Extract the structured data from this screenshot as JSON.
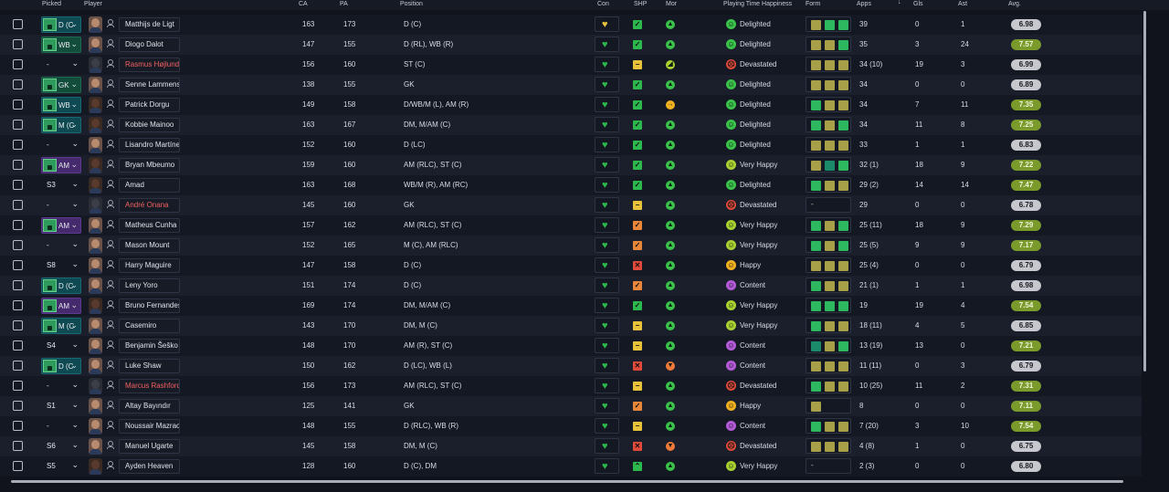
{
  "columns": {
    "picked": "Picked",
    "player": "Player",
    "ca": "CA",
    "pa": "PA",
    "position": "Position",
    "con": "Con",
    "shp": "SHP",
    "mor": "Mor",
    "happiness": "Playing Time Happiness",
    "form": "Form",
    "apps": "Apps",
    "sort_indicator": "↓",
    "gls": "Gls",
    "ast": "Ast",
    "avg": "Avg."
  },
  "colors": {
    "shp_good": "#2db84d",
    "shp_warn_yellow": "#e8c23a",
    "shp_warn_orange": "#e8873a",
    "shp_bad": "#e04a3a",
    "mor_good": "#3ac24a",
    "mor_ok": "#a8d030",
    "mor_warn": "#f0b020",
    "mor_bad": "#f07a3a",
    "hap_delighted": "#3ac24a",
    "hap_very_happy": "#a8d030",
    "hap_happy": "#f0b020",
    "hap_content": "#b45ad8",
    "hap_devastated": "#e04a3a",
    "form_green": "#2db860",
    "form_olive": "#a8a048",
    "form_teal": "#1a8a6a"
  },
  "players": [
    {
      "picked": "D (C",
      "picked_style": "teal",
      "pick_icon": true,
      "name": "Matthijs de Ligt",
      "name_red": false,
      "face": "light",
      "ca": "163",
      "pa": "173",
      "position": "D (C)",
      "con_icon": "heart-yellow",
      "shp": "good",
      "shp_glyph": "✓",
      "mor": "good",
      "mor_glyph": "▲",
      "hap": "delighted",
      "hap_glyph": "☺",
      "happiness": "Delighted",
      "form": [
        "olive",
        "green",
        "green"
      ],
      "form_empty": false,
      "apps": "39",
      "gls": "0",
      "ast": "1",
      "avg": "6.98",
      "avg_hi": false
    },
    {
      "picked": "WB",
      "picked_style": "green",
      "pick_icon": true,
      "name": "Diogo Dalot",
      "name_red": false,
      "face": "light",
      "ca": "147",
      "pa": "155",
      "position": "D (RL), WB (R)",
      "con_icon": "heart",
      "shp": "good",
      "shp_glyph": "✓",
      "mor": "good",
      "mor_glyph": "▲",
      "hap": "delighted",
      "hap_glyph": "☺",
      "happiness": "Delighted",
      "form": [
        "olive",
        "olive",
        "green"
      ],
      "form_empty": false,
      "apps": "35",
      "gls": "3",
      "ast": "24",
      "avg": "7.57",
      "avg_hi": true
    },
    {
      "picked": "-",
      "picked_style": "plain",
      "pick_icon": false,
      "name": "Rasmus Højlund",
      "name_red": true,
      "face": "blank",
      "ca": "156",
      "pa": "160",
      "position": "ST (C)",
      "con_icon": "heart",
      "shp": "warn_yellow",
      "shp_glyph": "−",
      "mor": "ok",
      "mor_glyph": "◢",
      "hap": "devastated",
      "hap_glyph": "☹",
      "happiness": "Devastated",
      "form": [
        "olive",
        "olive",
        "olive"
      ],
      "form_empty": false,
      "apps": "34 (10)",
      "gls": "19",
      "ast": "3",
      "avg": "6.99",
      "avg_hi": false
    },
    {
      "picked": "GK",
      "picked_style": "green",
      "pick_icon": true,
      "name": "Senne Lammens",
      "name_red": false,
      "face": "light",
      "ca": "138",
      "pa": "155",
      "position": "GK",
      "con_icon": "heart",
      "shp": "good",
      "shp_glyph": "✓",
      "mor": "good",
      "mor_glyph": "▲",
      "hap": "delighted",
      "hap_glyph": "☺",
      "happiness": "Delighted",
      "form": [
        "olive",
        "olive",
        "olive"
      ],
      "form_empty": false,
      "apps": "34",
      "gls": "0",
      "ast": "0",
      "avg": "6.89",
      "avg_hi": false
    },
    {
      "picked": "WB",
      "picked_style": "teal",
      "pick_icon": true,
      "name": "Patrick Dorgu",
      "name_red": false,
      "face": "dark",
      "ca": "149",
      "pa": "158",
      "position": "D/WB/M (L), AM (R)",
      "con_icon": "heart",
      "shp": "good",
      "shp_glyph": "✓",
      "mor": "warn",
      "mor_glyph": "→",
      "hap": "delighted",
      "hap_glyph": "☺",
      "happiness": "Delighted",
      "form": [
        "green",
        "olive",
        "olive"
      ],
      "form_empty": false,
      "apps": "34",
      "gls": "7",
      "ast": "11",
      "avg": "7.35",
      "avg_hi": true
    },
    {
      "picked": "M (C",
      "picked_style": "teal",
      "pick_icon": true,
      "name": "Kobbie Mainoo",
      "name_red": false,
      "face": "dark",
      "ca": "163",
      "pa": "167",
      "position": "DM, M/AM (C)",
      "con_icon": "heart",
      "shp": "good",
      "shp_glyph": "✓",
      "mor": "good",
      "mor_glyph": "▲",
      "hap": "delighted",
      "hap_glyph": "☺",
      "happiness": "Delighted",
      "form": [
        "green",
        "olive",
        "green"
      ],
      "form_empty": false,
      "apps": "34",
      "gls": "11",
      "ast": "8",
      "avg": "7.25",
      "avg_hi": true
    },
    {
      "picked": "-",
      "picked_style": "plain",
      "pick_icon": false,
      "name": "Lisandro Martínez",
      "name_red": false,
      "face": "light",
      "ca": "152",
      "pa": "160",
      "position": "D (LC)",
      "con_icon": "heart",
      "shp": "good",
      "shp_glyph": "✓",
      "mor": "good",
      "mor_glyph": "▲",
      "hap": "delighted",
      "hap_glyph": "☺",
      "happiness": "Delighted",
      "form": [
        "olive",
        "olive",
        "olive"
      ],
      "form_empty": false,
      "apps": "33",
      "gls": "1",
      "ast": "1",
      "avg": "6.83",
      "avg_hi": false
    },
    {
      "picked": "AM",
      "picked_style": "purple",
      "pick_icon": true,
      "name": "Bryan Mbeumo",
      "name_red": false,
      "face": "dark",
      "ca": "159",
      "pa": "160",
      "position": "AM (RLC), ST (C)",
      "con_icon": "heart",
      "shp": "good",
      "shp_glyph": "✓",
      "mor": "good",
      "mor_glyph": "▲",
      "hap": "very_happy",
      "hap_glyph": "☺",
      "happiness": "Very Happy",
      "form": [
        "olive",
        "teal",
        "green"
      ],
      "form_empty": false,
      "apps": "32 (1)",
      "gls": "18",
      "ast": "9",
      "avg": "7.22",
      "avg_hi": true
    },
    {
      "picked": "S3",
      "picked_style": "plain",
      "pick_icon": false,
      "name": "Amad",
      "name_red": false,
      "face": "dark",
      "ca": "163",
      "pa": "168",
      "position": "WB/M (R), AM (RC)",
      "con_icon": "heart",
      "shp": "good",
      "shp_glyph": "✓",
      "mor": "good",
      "mor_glyph": "▲",
      "hap": "delighted",
      "hap_glyph": "☺",
      "happiness": "Delighted",
      "form": [
        "green",
        "olive",
        "olive"
      ],
      "form_empty": false,
      "apps": "29 (2)",
      "gls": "14",
      "ast": "14",
      "avg": "7.47",
      "avg_hi": true
    },
    {
      "picked": "-",
      "picked_style": "plain",
      "pick_icon": false,
      "name": "André Onana",
      "name_red": true,
      "face": "blank",
      "ca": "145",
      "pa": "160",
      "position": "GK",
      "con_icon": "heart",
      "shp": "warn_yellow",
      "shp_glyph": "−",
      "mor": "good",
      "mor_glyph": "▲",
      "hap": "devastated",
      "hap_glyph": "☹",
      "happiness": "Devastated",
      "form": [],
      "form_empty": true,
      "apps": "29",
      "gls": "0",
      "ast": "0",
      "avg": "6.78",
      "avg_hi": false
    },
    {
      "picked": "AM",
      "picked_style": "purple",
      "pick_icon": true,
      "name": "Matheus Cunha",
      "name_red": false,
      "face": "light",
      "ca": "157",
      "pa": "162",
      "position": "AM (RLC), ST (C)",
      "con_icon": "heart",
      "shp": "warn_orange",
      "shp_glyph": "✓",
      "mor": "good",
      "mor_glyph": "▲",
      "hap": "very_happy",
      "hap_glyph": "☺",
      "happiness": "Very Happy",
      "form": [
        "green",
        "olive",
        "green"
      ],
      "form_empty": false,
      "apps": "25 (11)",
      "gls": "18",
      "ast": "9",
      "avg": "7.29",
      "avg_hi": true
    },
    {
      "picked": "-",
      "picked_style": "plain",
      "pick_icon": false,
      "name": "Mason Mount",
      "name_red": false,
      "face": "light",
      "ca": "152",
      "pa": "165",
      "position": "M (C), AM (RLC)",
      "con_icon": "heart",
      "shp": "warn_orange",
      "shp_glyph": "✓",
      "mor": "good",
      "mor_glyph": "▲",
      "hap": "very_happy",
      "hap_glyph": "☺",
      "happiness": "Very Happy",
      "form": [
        "green",
        "olive",
        "green"
      ],
      "form_empty": false,
      "apps": "25 (5)",
      "gls": "9",
      "ast": "9",
      "avg": "7.17",
      "avg_hi": true
    },
    {
      "picked": "S8",
      "picked_style": "plain",
      "pick_icon": false,
      "name": "Harry Maguire",
      "name_red": false,
      "face": "light",
      "ca": "147",
      "pa": "158",
      "position": "D (C)",
      "con_icon": "heart",
      "shp": "bad",
      "shp_glyph": "✕",
      "mor": "good",
      "mor_glyph": "▲",
      "hap": "happy",
      "hap_glyph": "☺",
      "happiness": "Happy",
      "form": [
        "olive",
        "olive",
        "olive"
      ],
      "form_empty": false,
      "apps": "25 (4)",
      "gls": "0",
      "ast": "0",
      "avg": "6.79",
      "avg_hi": false
    },
    {
      "picked": "D (C",
      "picked_style": "teal",
      "pick_icon": true,
      "name": "Leny Yoro",
      "name_red": false,
      "face": "light",
      "ca": "151",
      "pa": "174",
      "position": "D (C)",
      "con_icon": "heart",
      "shp": "warn_orange",
      "shp_glyph": "✓",
      "mor": "good",
      "mor_glyph": "▲",
      "hap": "content",
      "hap_glyph": "☺",
      "happiness": "Content",
      "form": [
        "green",
        "olive",
        "olive"
      ],
      "form_empty": false,
      "apps": "21 (1)",
      "gls": "1",
      "ast": "1",
      "avg": "6.98",
      "avg_hi": false
    },
    {
      "picked": "AM",
      "picked_style": "purple",
      "pick_icon": true,
      "name": "Bruno Fernandes",
      "name_red": false,
      "face": "dark",
      "ca": "169",
      "pa": "174",
      "position": "DM, M/AM (C)",
      "con_icon": "heart",
      "shp": "good",
      "shp_glyph": "✓",
      "mor": "good",
      "mor_glyph": "▲",
      "hap": "very_happy",
      "hap_glyph": "☺",
      "happiness": "Very Happy",
      "form": [
        "green",
        "green",
        "green"
      ],
      "form_empty": false,
      "apps": "19",
      "gls": "19",
      "ast": "4",
      "avg": "7.54",
      "avg_hi": true
    },
    {
      "picked": "M (C",
      "picked_style": "teal",
      "pick_icon": true,
      "name": "Casemiro",
      "name_red": false,
      "face": "light",
      "ca": "143",
      "pa": "170",
      "position": "DM, M (C)",
      "con_icon": "heart",
      "shp": "warn_yellow",
      "shp_glyph": "−",
      "mor": "good",
      "mor_glyph": "▲",
      "hap": "very_happy",
      "hap_glyph": "☺",
      "happiness": "Very Happy",
      "form": [
        "green",
        "olive",
        "olive"
      ],
      "form_empty": false,
      "apps": "18 (11)",
      "gls": "4",
      "ast": "5",
      "avg": "6.85",
      "avg_hi": false
    },
    {
      "picked": "S4",
      "picked_style": "plain",
      "pick_icon": false,
      "name": "Benjamin Šeško",
      "name_red": false,
      "face": "light",
      "ca": "148",
      "pa": "170",
      "position": "AM (R), ST (C)",
      "con_icon": "heart",
      "shp": "warn_yellow",
      "shp_glyph": "−",
      "mor": "good",
      "mor_glyph": "▲",
      "hap": "content",
      "hap_glyph": "☺",
      "happiness": "Content",
      "form": [
        "teal",
        "olive",
        "green"
      ],
      "form_empty": false,
      "apps": "13 (19)",
      "gls": "13",
      "ast": "0",
      "avg": "7.21",
      "avg_hi": true
    },
    {
      "picked": "D (C",
      "picked_style": "teal",
      "pick_icon": true,
      "name": "Luke Shaw",
      "name_red": false,
      "face": "light",
      "ca": "150",
      "pa": "162",
      "position": "D (LC), WB (L)",
      "con_icon": "heart",
      "shp": "bad",
      "shp_glyph": "✕",
      "mor": "bad",
      "mor_glyph": "▼",
      "hap": "content",
      "hap_glyph": "☺",
      "happiness": "Content",
      "form": [
        "olive",
        "olive",
        "olive"
      ],
      "form_empty": false,
      "apps": "11 (11)",
      "gls": "0",
      "ast": "3",
      "avg": "6.79",
      "avg_hi": false
    },
    {
      "picked": "-",
      "picked_style": "plain",
      "pick_icon": false,
      "name": "Marcus Rashford",
      "name_red": true,
      "face": "blank",
      "ca": "156",
      "pa": "173",
      "position": "AM (RLC), ST (C)",
      "con_icon": "heart",
      "shp": "warn_yellow",
      "shp_glyph": "−",
      "mor": "good",
      "mor_glyph": "▲",
      "hap": "devastated",
      "hap_glyph": "☹",
      "happiness": "Devastated",
      "form": [
        "green",
        "olive",
        "olive"
      ],
      "form_empty": false,
      "apps": "10 (25)",
      "gls": "11",
      "ast": "2",
      "avg": "7.31",
      "avg_hi": true
    },
    {
      "picked": "S1",
      "picked_style": "plain",
      "pick_icon": false,
      "name": "Altay Bayındır",
      "name_red": false,
      "face": "light",
      "ca": "125",
      "pa": "141",
      "position": "GK",
      "con_icon": "heart",
      "shp": "warn_orange",
      "shp_glyph": "✓",
      "mor": "good",
      "mor_glyph": "▲",
      "hap": "happy",
      "hap_glyph": "☺",
      "happiness": "Happy",
      "form": [
        "olive"
      ],
      "form_empty": false,
      "apps": "8",
      "gls": "0",
      "ast": "0",
      "avg": "7.11",
      "avg_hi": true
    },
    {
      "picked": "-",
      "picked_style": "plain",
      "pick_icon": false,
      "name": "Noussair Mazraoui",
      "name_red": false,
      "face": "light",
      "ca": "148",
      "pa": "155",
      "position": "D (RLC), WB (R)",
      "con_icon": "heart",
      "shp": "warn_yellow",
      "shp_glyph": "−",
      "mor": "good",
      "mor_glyph": "▲",
      "hap": "content",
      "hap_glyph": "☺",
      "happiness": "Content",
      "form": [
        "green",
        "olive",
        "olive"
      ],
      "form_empty": false,
      "apps": "7 (20)",
      "gls": "3",
      "ast": "10",
      "avg": "7.54",
      "avg_hi": true
    },
    {
      "picked": "S6",
      "picked_style": "plain",
      "pick_icon": false,
      "name": "Manuel Ugarte",
      "name_red": false,
      "face": "light",
      "ca": "145",
      "pa": "158",
      "position": "DM, M (C)",
      "con_icon": "heart",
      "shp": "bad",
      "shp_glyph": "✕",
      "mor": "bad",
      "mor_glyph": "▼",
      "hap": "devastated",
      "hap_glyph": "☹",
      "happiness": "Devastated",
      "form": [
        "olive",
        "olive",
        "olive"
      ],
      "form_empty": false,
      "apps": "4 (8)",
      "gls": "1",
      "ast": "0",
      "avg": "6.75",
      "avg_hi": false
    },
    {
      "picked": "S5",
      "picked_style": "plain",
      "pick_icon": false,
      "name": "Ayden Heaven",
      "name_red": false,
      "face": "dark",
      "ca": "128",
      "pa": "160",
      "position": "D (C), DM",
      "con_icon": "heart",
      "shp": "good_up",
      "shp_glyph": "⌃",
      "mor": "good",
      "mor_glyph": "▲",
      "hap": "very_happy",
      "hap_glyph": "☺",
      "happiness": "Very Happy",
      "form": [],
      "form_empty": true,
      "apps": "2 (3)",
      "gls": "0",
      "ast": "0",
      "avg": "6.80",
      "avg_hi": false
    }
  ]
}
